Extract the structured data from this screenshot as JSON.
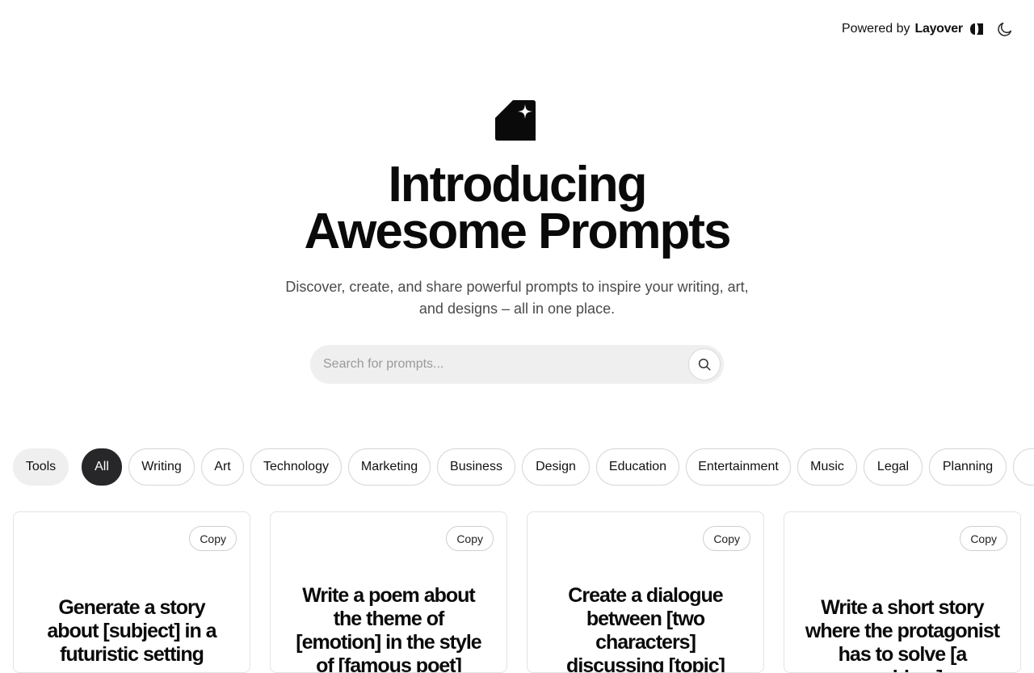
{
  "header": {
    "powered_by_label": "Powered by",
    "brand_name": "Layover",
    "theme_toggle_icon": "moon-icon"
  },
  "hero": {
    "logo_icon": "sparkle-card-icon",
    "title_line1": "Introducing",
    "title_line2": "Awesome Prompts",
    "subtitle": "Discover, create, and share powerful prompts to inspire your writing, art, and designs – all in one place."
  },
  "search": {
    "placeholder": "Search for prompts...",
    "value": "",
    "button_icon": "search-icon"
  },
  "categories": {
    "tools_label": "Tools",
    "items": [
      "All",
      "Writing",
      "Art",
      "Technology",
      "Marketing",
      "Business",
      "Design",
      "Education",
      "Entertainment",
      "Music",
      "Legal",
      "Planning"
    ],
    "selected": "All"
  },
  "cards": [
    {
      "copy_label": "Copy",
      "text": "Generate a story about [subject] in a futuristic setting"
    },
    {
      "copy_label": "Copy",
      "text": "Write a poem about the theme of [emotion] in the style of [famous poet]"
    },
    {
      "copy_label": "Copy",
      "text": "Create a dialogue between [two characters] discussing [topic]"
    },
    {
      "copy_label": "Copy",
      "text": "Write a short story where the protagonist has to solve [a problem]"
    }
  ],
  "colors": {
    "active_chip": "#27272a",
    "search_bg": "#efefef",
    "text_primary": "#0a0a0a"
  }
}
